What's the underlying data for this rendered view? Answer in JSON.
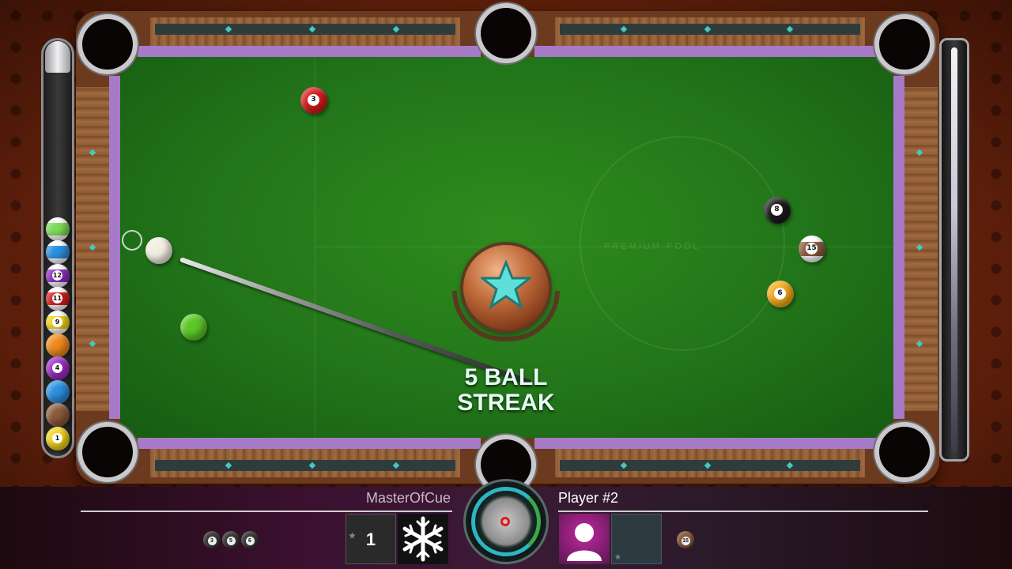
{
  "colors": {
    "felt": "#22751a",
    "cushion": "#a77ac8",
    "streak_text": "#e6fbf3",
    "hud_bg": "#3b1030",
    "spin_ring": "#2cb6c2",
    "spin_dot": "#e01a1a"
  },
  "table": {
    "felt_logo": "PREMIUM POOL"
  },
  "streak": {
    "line1": "5 BALL",
    "line2": "STREAK",
    "icon": "star-icon"
  },
  "table_balls": [
    {
      "id": "cue",
      "label": "",
      "color": "#f2eee2",
      "striped": false
    },
    {
      "id": "ball-3",
      "label": "3",
      "color": "#d81b1b",
      "striped": false
    },
    {
      "id": "ball-green",
      "label": "",
      "color": "#5bc726",
      "striped": false
    },
    {
      "id": "ball-8",
      "label": "8",
      "color": "#1a1a1a",
      "striped": false
    },
    {
      "id": "ball-15",
      "label": "15",
      "color": "#8b5a3c",
      "striped": true
    },
    {
      "id": "ball-6",
      "label": "6",
      "color": "#f2a91b",
      "striped": false
    }
  ],
  "pocketed_rack": [
    {
      "label": "",
      "color": "#7ed957",
      "striped": true
    },
    {
      "label": "",
      "color": "#2b8fe0",
      "striped": true
    },
    {
      "label": "12",
      "color": "#8e2bc4",
      "striped": true
    },
    {
      "label": "11",
      "color": "#d81b1b",
      "striped": true
    },
    {
      "label": "9",
      "color": "#f0d21b",
      "striped": true
    },
    {
      "label": "",
      "color": "#f08a1b",
      "striped": false
    },
    {
      "label": "4",
      "color": "#9b2bc4",
      "striped": false
    },
    {
      "label": "",
      "color": "#2b8fe0",
      "striped": false
    },
    {
      "label": "",
      "color": "#8b5a3c",
      "striped": false
    },
    {
      "label": "1",
      "color": "#f0d21b",
      "striped": false
    }
  ],
  "hud": {
    "player1": {
      "name": "MasterOfCue",
      "score": "1",
      "avatar_icon": "snowflake-icon",
      "remaining_balls": [
        "3",
        "5",
        "6"
      ]
    },
    "player2": {
      "name": "Player #2",
      "avatar_icon": "user-silhouette-icon",
      "remaining_balls": [
        "15"
      ]
    }
  }
}
